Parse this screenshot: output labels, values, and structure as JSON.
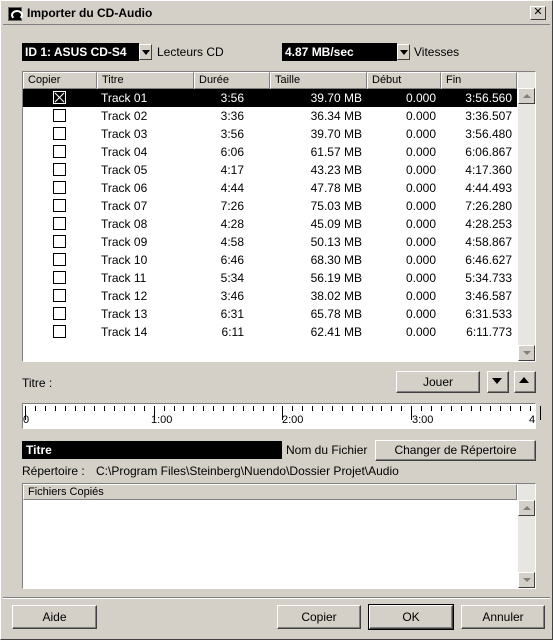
{
  "window": {
    "title": "Importer du CD-Audio",
    "close_glyph": "✕"
  },
  "drives": {
    "selected": "ID 1: ASUS    CD-S4",
    "label": "Lecteurs CD"
  },
  "speeds": {
    "selected": "4.87 MB/sec",
    "label": "Vitesses"
  },
  "table": {
    "columns": [
      "Copier",
      "Titre",
      "Durée",
      "Taille",
      "Début",
      "Fin"
    ],
    "rows": [
      {
        "checked": true,
        "title": "Track 01",
        "duration": "3:56",
        "size": "39.70 MB",
        "start": "0.000",
        "end": "3:56.560"
      },
      {
        "checked": false,
        "title": "Track 02",
        "duration": "3:36",
        "size": "36.34 MB",
        "start": "0.000",
        "end": "3:36.507"
      },
      {
        "checked": false,
        "title": "Track 03",
        "duration": "3:56",
        "size": "39.70 MB",
        "start": "0.000",
        "end": "3:56.480"
      },
      {
        "checked": false,
        "title": "Track 04",
        "duration": "6:06",
        "size": "61.57 MB",
        "start": "0.000",
        "end": "6:06.867"
      },
      {
        "checked": false,
        "title": "Track 05",
        "duration": "4:17",
        "size": "43.23 MB",
        "start": "0.000",
        "end": "4:17.360"
      },
      {
        "checked": false,
        "title": "Track 06",
        "duration": "4:44",
        "size": "47.78 MB",
        "start": "0.000",
        "end": "4:44.493"
      },
      {
        "checked": false,
        "title": "Track 07",
        "duration": "7:26",
        "size": "75.03 MB",
        "start": "0.000",
        "end": "7:26.280"
      },
      {
        "checked": false,
        "title": "Track 08",
        "duration": "4:28",
        "size": "45.09 MB",
        "start": "0.000",
        "end": "4:28.253"
      },
      {
        "checked": false,
        "title": "Track 09",
        "duration": "4:58",
        "size": "50.13 MB",
        "start": "0.000",
        "end": "4:58.867"
      },
      {
        "checked": false,
        "title": "Track 10",
        "duration": "6:46",
        "size": "68.30 MB",
        "start": "0.000",
        "end": "6:46.627"
      },
      {
        "checked": false,
        "title": "Track 11",
        "duration": "5:34",
        "size": "56.19 MB",
        "start": "0.000",
        "end": "5:34.733"
      },
      {
        "checked": false,
        "title": "Track 12",
        "duration": "3:46",
        "size": "38.02 MB",
        "start": "0.000",
        "end": "3:46.587"
      },
      {
        "checked": false,
        "title": "Track 13",
        "duration": "6:31",
        "size": "65.78 MB",
        "start": "0.000",
        "end": "6:31.533"
      },
      {
        "checked": false,
        "title": "Track 14",
        "duration": "6:11",
        "size": "62.41 MB",
        "start": "0.000",
        "end": "6:11.773"
      }
    ]
  },
  "player": {
    "title_label": "Titre :",
    "play_button": "Jouer"
  },
  "ruler": {
    "start_label": "0",
    "end_label": "4",
    "marks": [
      "1:00",
      "2:00",
      "3:00"
    ]
  },
  "naming": {
    "title_value": "Titre",
    "filename_label": "Nom du Fichier",
    "change_dir_button": "Changer de Répertoire",
    "directory_label": "Répertoire :",
    "directory_path": "C:\\Program Files\\Steinberg\\Nuendo\\Dossier Projet\\Audio"
  },
  "copied_files": {
    "header": "Fichiers Copiés"
  },
  "footer": {
    "help": "Aide",
    "copy": "Copier",
    "ok": "OK",
    "cancel": "Annuler"
  }
}
